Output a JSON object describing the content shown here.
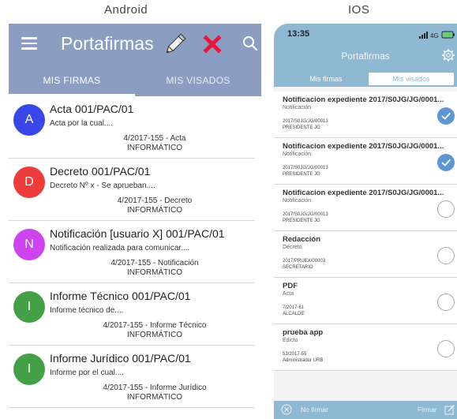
{
  "labels": {
    "android": "Android",
    "ios": "IOS"
  },
  "colors": {
    "android_bar": "#8b9ec2",
    "ios_bar": "#8fb8d2",
    "ios_check": "#5e95d3",
    "close_red": "#e8163a"
  },
  "android": {
    "title": "Portafirmas",
    "icons": [
      "menu-icon",
      "pencil-icon",
      "close-icon",
      "search-icon"
    ],
    "tabs": [
      {
        "label": "MIS FIRMAS",
        "active": true
      },
      {
        "label": "MIS VISADOS",
        "active": false
      }
    ],
    "items": [
      {
        "letter": "A",
        "color": "#3a47e8",
        "title": "Acta 001/PAC/01",
        "subtitle": "Acta por la cual....",
        "meta": "4/2017-155  -  Acta",
        "org": "INFORMÁTICO"
      },
      {
        "letter": "D",
        "color": "#ee3b3b",
        "title": "Decreto 001/PAC/01",
        "subtitle": "Decreto Nº x - Se aprueban....",
        "meta": "4/2017-155  -  Decreto",
        "org": "INFORMÁTICO"
      },
      {
        "letter": "N",
        "color": "#cc44ee",
        "title": "Notificación [usuario X] 001/PAC/01",
        "subtitle": "Notificación realizada para comunicar....",
        "meta": "4/2017-155  -  Notificación",
        "org": "INFORMÁTICO"
      },
      {
        "letter": "I",
        "color": "#43a047",
        "title": "Informe Técnico 001/PAC/01",
        "subtitle": "Informe técnico de....",
        "meta": "4/2017-155  -  Informe Técnico",
        "org": "INFORMÁTICO"
      },
      {
        "letter": "I",
        "color": "#43a047",
        "title": "Informe Jurídico 001/PAC/01",
        "subtitle": "Informe por el cual....",
        "meta": "4/2017-155  -  Informe Jurídico",
        "org": "INFORMÁTICO"
      }
    ]
  },
  "ios": {
    "time": "13:35",
    "network": "4G",
    "title": "Portafirmas",
    "segments": [
      {
        "label": "Mis firmas",
        "active": true
      },
      {
        "label": "Mis visados",
        "active": false
      }
    ],
    "items": [
      {
        "title": "Notificacion expediente 2017/S0JG/JG/0001...",
        "type": "Notificación",
        "ref": "2017/S0JG/JG/00013",
        "owner": "PRESIDENTE JG",
        "checked": true
      },
      {
        "title": "Notificacion expediente 2017/S0JG/JG/0001...",
        "type": "Notificación",
        "ref": "2017/S0JG/JG/00013",
        "owner": "PRESIDENTE JG",
        "checked": true
      },
      {
        "title": "Notificacion expediente 2017/S0JG/JG/0001...",
        "type": "Notificación",
        "ref": "2017/S0JG/JG/00013",
        "owner": "PRESIDENTE JG",
        "checked": false
      },
      {
        "title": "Redacción",
        "type": "Decreto",
        "ref": "2017/PRUEX/00003",
        "owner": "SECRETARIO",
        "checked": false
      },
      {
        "title": "PDF",
        "type": "Acta",
        "ref": "7/2017-61",
        "owner": "ALCALDE",
        "checked": false
      },
      {
        "title": "prueba app",
        "type": "Edicto",
        "ref": "53/2017-55",
        "owner": "Administrador URB",
        "checked": false
      }
    ],
    "bottom": {
      "left_label": "No firmar",
      "right_label": "Firmar"
    }
  }
}
